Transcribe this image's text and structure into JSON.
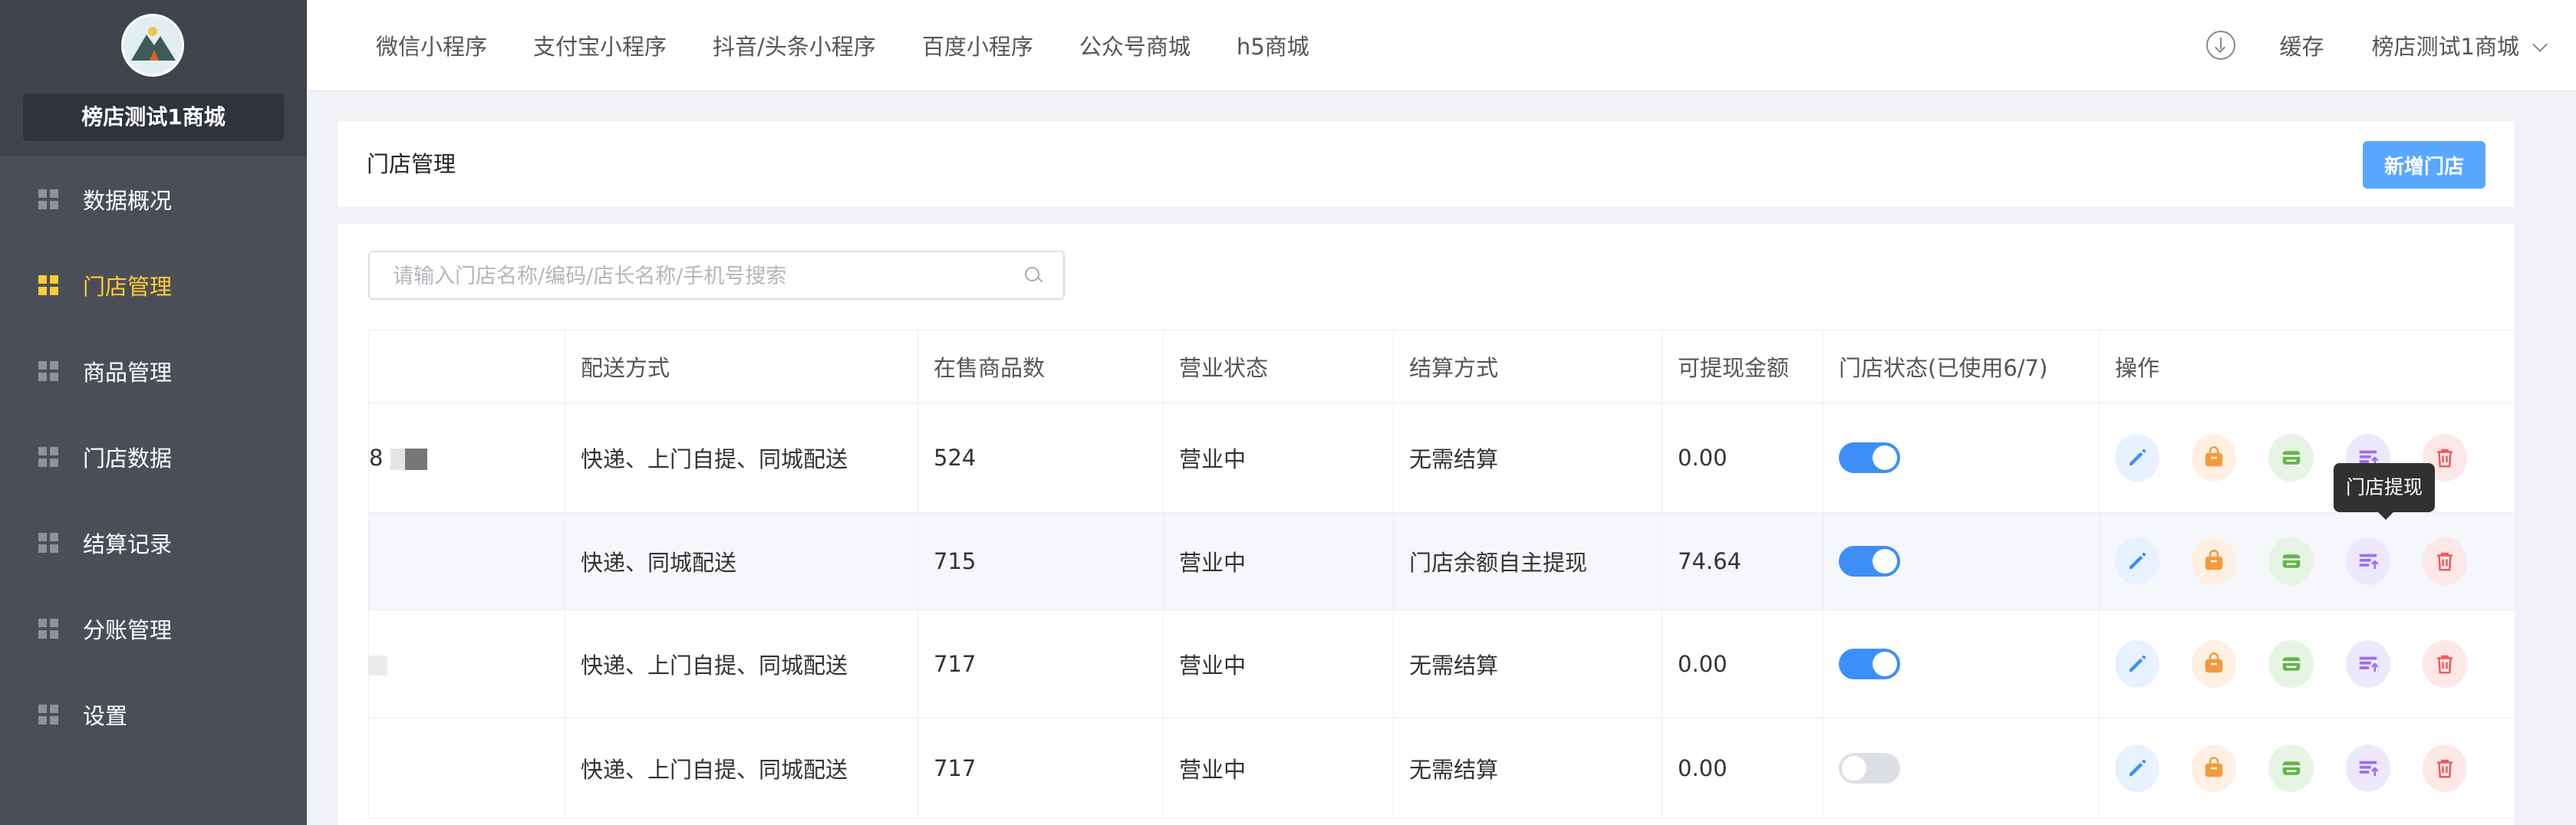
{
  "sidebar": {
    "shop_name": "榜店测试1商城",
    "items": [
      {
        "label": "数据概况",
        "active": false
      },
      {
        "label": "门店管理",
        "active": true
      },
      {
        "label": "商品管理",
        "active": false
      },
      {
        "label": "门店数据",
        "active": false
      },
      {
        "label": "结算记录",
        "active": false
      },
      {
        "label": "分账管理",
        "active": false
      },
      {
        "label": "设置",
        "active": false
      }
    ]
  },
  "topbar": {
    "tabs": [
      "微信小程序",
      "支付宝小程序",
      "抖音/头条小程序",
      "百度小程序",
      "公众号商城",
      "h5商城"
    ],
    "cache_label": "缓存",
    "account_label": "榜店测试1商城",
    "download_icon": "download-icon"
  },
  "page": {
    "title": "门店管理",
    "add_button": "新增门店"
  },
  "search": {
    "placeholder": "请输入门店名称/编码/店长名称/手机号搜索",
    "value": ""
  },
  "table": {
    "headers": [
      "",
      "配送方式",
      "在售商品数",
      "营业状态",
      "结算方式",
      "可提现金额",
      "门店状态(已使用6/7)",
      "操作"
    ],
    "rows": [
      {
        "name_fragment": "8",
        "delivery": "快递、上门自提、同城配送",
        "products": "524",
        "status": "营业中",
        "settlement": "无需结算",
        "amount": "0.00",
        "enabled": true
      },
      {
        "name_fragment": "",
        "delivery": "快递、同城配送",
        "products": "715",
        "status": "营业中",
        "settlement": "门店余额自主提现",
        "amount": "74.64",
        "enabled": true
      },
      {
        "name_fragment": "",
        "delivery": "快递、上门自提、同城配送",
        "products": "717",
        "status": "营业中",
        "settlement": "无需结算",
        "amount": "0.00",
        "enabled": true
      },
      {
        "name_fragment": "",
        "delivery": "快递、上门自提、同城配送",
        "products": "717",
        "status": "营业中",
        "settlement": "无需结算",
        "amount": "0.00",
        "enabled": false
      }
    ]
  },
  "tooltip": {
    "text": "门店提现"
  },
  "colors": {
    "sidebar_bg": "#4a4f57",
    "active": "#ffcc33",
    "primary": "#5aa7ff",
    "switch_on": "#3e8ef7"
  }
}
